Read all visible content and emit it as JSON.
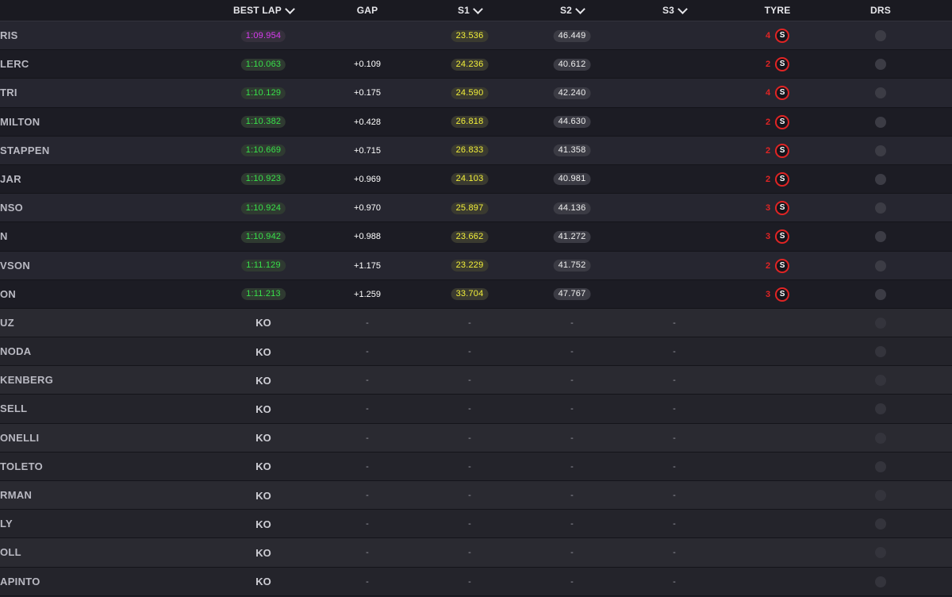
{
  "header": {
    "best_lap": "BEST LAP",
    "gap": "GAP",
    "s1": "S1",
    "s2": "S2",
    "s3": "S3",
    "tyre": "TYRE",
    "drs": "DRS"
  },
  "colors": {
    "purple": "#d93cf0",
    "green": "#38e04a",
    "yellow": "#f3f03a",
    "soft_tyre": "#e02424"
  },
  "rows": [
    {
      "driver": "RIS",
      "best_lap": "1:09.954",
      "lap_color": "purple",
      "gap": "",
      "s1": "23.536",
      "s2": "46.449",
      "s3": "",
      "laps": "4",
      "tyre": "S"
    },
    {
      "driver": "LERC",
      "best_lap": "1:10.063",
      "lap_color": "green",
      "gap": "+0.109",
      "s1": "24.236",
      "s2": "40.612",
      "s3": "",
      "laps": "2",
      "tyre": "S"
    },
    {
      "driver": "TRI",
      "best_lap": "1:10.129",
      "lap_color": "green",
      "gap": "+0.175",
      "s1": "24.590",
      "s2": "42.240",
      "s3": "",
      "laps": "4",
      "tyre": "S"
    },
    {
      "driver": "MILTON",
      "best_lap": "1:10.382",
      "lap_color": "green",
      "gap": "+0.428",
      "s1": "26.818",
      "s2": "44.630",
      "s3": "",
      "laps": "2",
      "tyre": "S"
    },
    {
      "driver": "STAPPEN",
      "best_lap": "1:10.669",
      "lap_color": "green",
      "gap": "+0.715",
      "s1": "26.833",
      "s2": "41.358",
      "s3": "",
      "laps": "2",
      "tyre": "S"
    },
    {
      "driver": "JAR",
      "best_lap": "1:10.923",
      "lap_color": "green",
      "gap": "+0.969",
      "s1": "24.103",
      "s2": "40.981",
      "s3": "",
      "laps": "2",
      "tyre": "S"
    },
    {
      "driver": "NSO",
      "best_lap": "1:10.924",
      "lap_color": "green",
      "gap": "+0.970",
      "s1": "25.897",
      "s2": "44.136",
      "s3": "",
      "laps": "3",
      "tyre": "S"
    },
    {
      "driver": "N",
      "best_lap": "1:10.942",
      "lap_color": "green",
      "gap": "+0.988",
      "s1": "23.662",
      "s2": "41.272",
      "s3": "",
      "laps": "3",
      "tyre": "S"
    },
    {
      "driver": "VSON",
      "best_lap": "1:11.129",
      "lap_color": "green",
      "gap": "+1.175",
      "s1": "23.229",
      "s2": "41.752",
      "s3": "",
      "laps": "2",
      "tyre": "S"
    },
    {
      "driver": "ON",
      "best_lap": "1:11.213",
      "lap_color": "green",
      "gap": "+1.259",
      "s1": "33.704",
      "s2": "47.767",
      "s3": "",
      "laps": "3",
      "tyre": "S"
    }
  ],
  "ko_rows": [
    {
      "driver": "UZ",
      "result": "KO",
      "gap": "-",
      "s1": "-",
      "s2": "-",
      "s3": "-"
    },
    {
      "driver": "NODA",
      "result": "KO",
      "gap": "-",
      "s1": "-",
      "s2": "-",
      "s3": "-"
    },
    {
      "driver": "KENBERG",
      "result": "KO",
      "gap": "-",
      "s1": "-",
      "s2": "-",
      "s3": "-"
    },
    {
      "driver": "SELL",
      "result": "KO",
      "gap": "-",
      "s1": "-",
      "s2": "-",
      "s3": "-"
    },
    {
      "driver": "ONELLI",
      "result": "KO",
      "gap": "-",
      "s1": "-",
      "s2": "-",
      "s3": "-"
    },
    {
      "driver": "TOLETO",
      "result": "KO",
      "gap": "-",
      "s1": "-",
      "s2": "-",
      "s3": "-"
    },
    {
      "driver": "RMAN",
      "result": "KO",
      "gap": "-",
      "s1": "-",
      "s2": "-",
      "s3": "-"
    },
    {
      "driver": "LY",
      "result": "KO",
      "gap": "-",
      "s1": "-",
      "s2": "-",
      "s3": "-"
    },
    {
      "driver": "OLL",
      "result": "KO",
      "gap": "-",
      "s1": "-",
      "s2": "-",
      "s3": "-"
    },
    {
      "driver": "APINTO",
      "result": "KO",
      "gap": "-",
      "s1": "-",
      "s2": "-",
      "s3": "-"
    }
  ]
}
